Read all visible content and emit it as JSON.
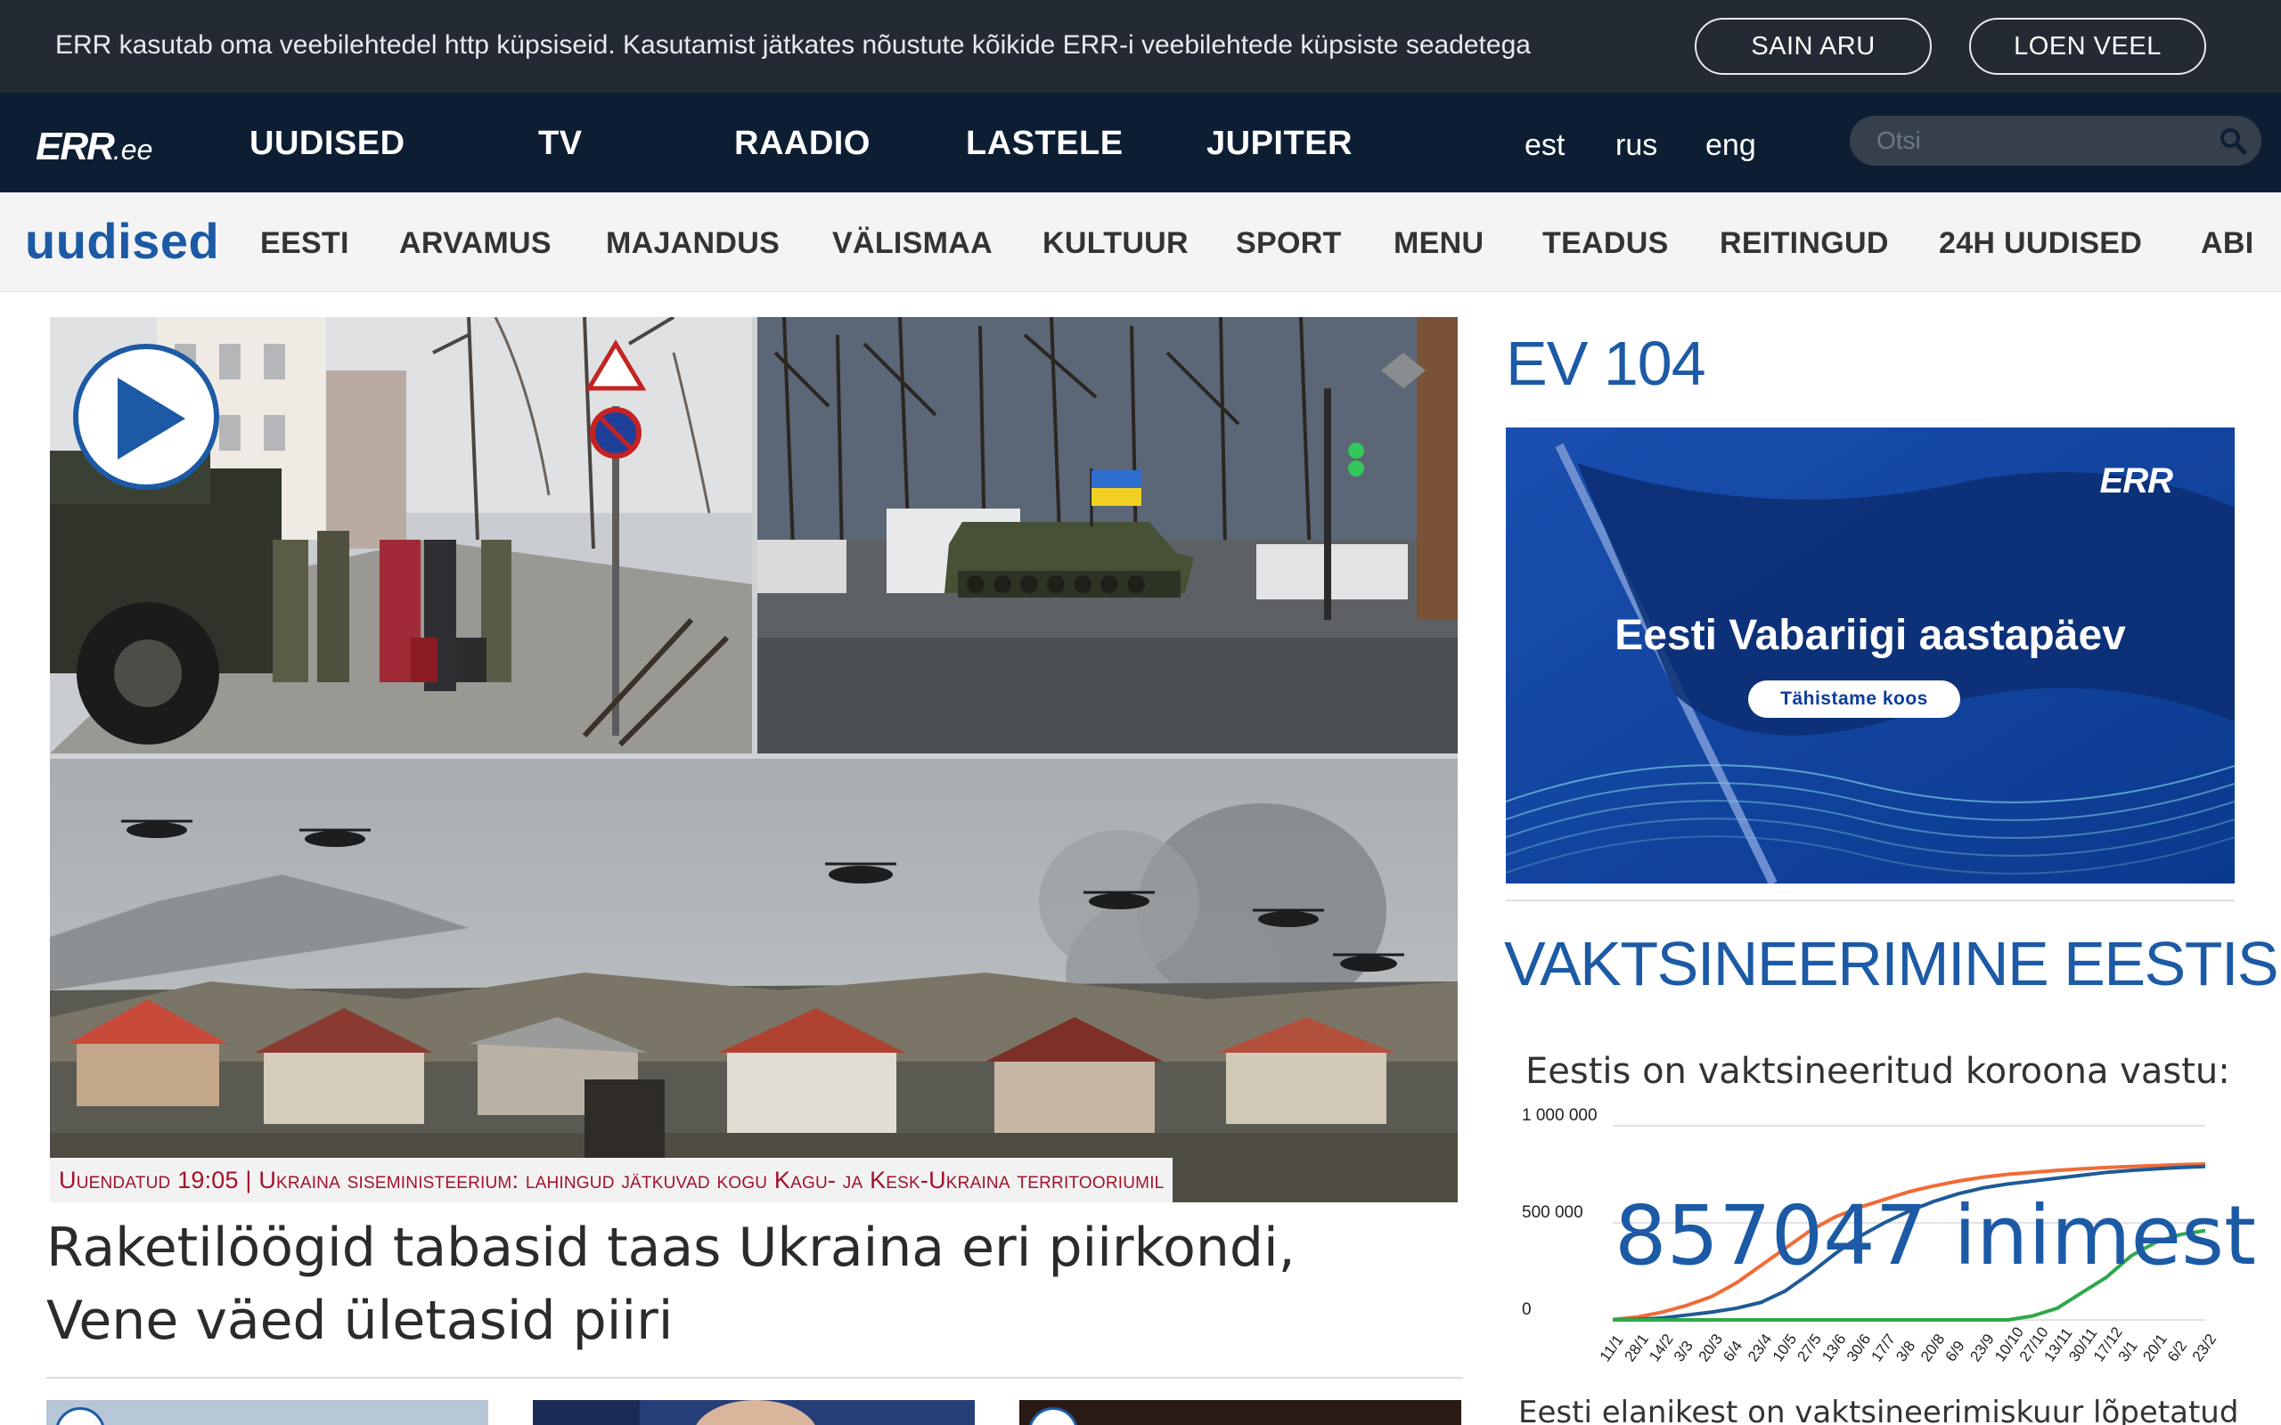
{
  "cookie": {
    "text": "ERR kasutab oma veebilehtedel http küpsiseid. Kasutamist jätkates nõustute kõikide ERR-i veebilehtede küpsiste seadetega",
    "ok_label": "SAIN ARU",
    "more_label": "LOEN VEEL"
  },
  "header": {
    "logo_main": "ERR",
    "logo_suffix": ".ee",
    "nav": [
      "UUDISED",
      "TV",
      "RAADIO",
      "LASTELE",
      "JUPITER"
    ],
    "languages": [
      "est",
      "rus",
      "eng"
    ],
    "search_placeholder": "Otsi"
  },
  "subnav": {
    "section_title": "uudised",
    "items": [
      "EESTI",
      "ARVAMUS",
      "MAJANDUS",
      "VÄLISMAA",
      "KULTUUR",
      "SPORT",
      "MENU",
      "TEADUS",
      "REITINGUD",
      "24H UUDISED",
      "ABI"
    ]
  },
  "main_story": {
    "caption": "Uuendatud 19:05 | Ukraina siseministeerium: lahingud jätkuvad kogu Kagu- ja Kesk-Ukraina territooriumil",
    "headline": "Raketilöögid tabasid taas Ukraina eri piirkondi, Vene väed ületasid piiri"
  },
  "sidebar": {
    "ev_title": "EV 104",
    "banner": {
      "logo": "ERR",
      "title": "Eesti Vabariigi aastapäev",
      "button": "Tähistame koos"
    },
    "vax_title": "VAKTSINEERIMINE EESTIS",
    "vax_subtitle": "Eestis on vaktsineeritud koroona vastu:",
    "vax_number": "857047",
    "vax_unit": "inimest",
    "vax_bottom_text": "Eesti elanikest on vaktsineerimiskuur lõpetatud"
  },
  "chart_data": {
    "type": "line",
    "x": [
      "11/1",
      "28/1",
      "14/2",
      "3/3",
      "20/3",
      "6/4",
      "23/4",
      "10/5",
      "27/5",
      "13/6",
      "30/6",
      "17/7",
      "3/8",
      "20/8",
      "6/9",
      "23/9",
      "10/10",
      "27/10",
      "13/11",
      "30/11",
      "17/12",
      "3/1",
      "20/1",
      "6/2",
      "23/2"
    ],
    "y_ticks": [
      "1 000 000",
      "500 000",
      "0"
    ],
    "ylim": [
      0,
      1000000
    ],
    "series": [
      {
        "color": "#f26a36",
        "values": [
          2000,
          15000,
          40000,
          75000,
          120000,
          190000,
          280000,
          370000,
          460000,
          530000,
          580000,
          620000,
          660000,
          690000,
          715000,
          735000,
          750000,
          760000,
          770000,
          778000,
          785000,
          790000,
          795000,
          800000,
          803000
        ]
      },
      {
        "color": "#1f5a96",
        "values": [
          0,
          3000,
          10000,
          25000,
          40000,
          60000,
          90000,
          150000,
          240000,
          340000,
          430000,
          500000,
          560000,
          610000,
          650000,
          680000,
          700000,
          715000,
          730000,
          745000,
          760000,
          770000,
          778000,
          785000,
          790000
        ]
      },
      {
        "color": "#2ea84a",
        "values": [
          0,
          0,
          0,
          0,
          0,
          0,
          0,
          0,
          0,
          0,
          0,
          0,
          0,
          0,
          0,
          0,
          0,
          20000,
          60000,
          140000,
          220000,
          330000,
          400000,
          440000,
          460000
        ]
      }
    ],
    "grid": true,
    "legend": "none"
  },
  "colors": {
    "brand_blue": "#1c5aa6",
    "nav_bg": "#0d1e33",
    "cookie_bg": "#232a33",
    "caption_red": "#a4112a"
  }
}
